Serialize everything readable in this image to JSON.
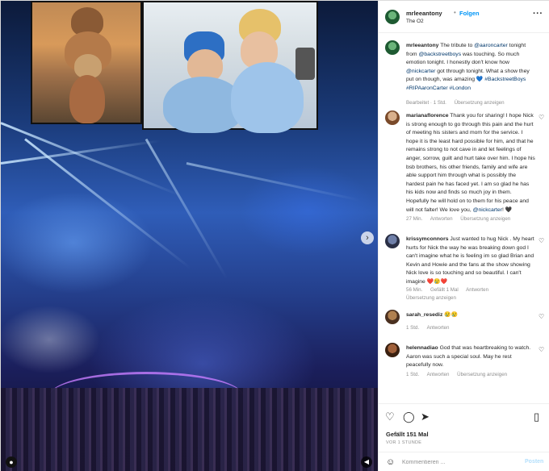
{
  "header": {
    "username": "mrleeantony",
    "separator": "•",
    "follow_label": "Folgen",
    "location": "The O2",
    "more": "···"
  },
  "caption": {
    "username": "mrleeantony",
    "text_1": "The tribute to ",
    "mention_1": "@aaroncarter",
    "text_2": " tonight from ",
    "mention_2": "@backstreetboys",
    "text_3": " was touching. So much emotion tonight. I honestly don't know how ",
    "mention_3": "@nickcarter",
    "text_4": " got through tonight. What a show they put on though, was amazing 💙 ",
    "hashtag_1": "#BackstreetBoys",
    "hashtag_2": "#RIPAaronCarter",
    "hashtag_3": "#London",
    "meta_edited": "Bearbeitet · 1 Std.",
    "meta_translate": "Übersetzung anzeigen"
  },
  "comments": [
    {
      "username": "marianaflorence",
      "text": "Thank you for sharing! I hope Nick is strong enough to go through this pain and the hurt of meeting his sisters and mom for the service. I hope it is the least hard possible for him, and that he remains strong to not cave in and let feelings of anger, sorrow, guilt and hurt take over him. I hope his bsb brothers, his other friends, family and wife are able support him through what is possibly the hardest pain he has faced yet. I am so glad he has his kids now and finds so much joy in them. Hopefully he will hold on to them for his peace and will not falter! We love you, ",
      "mention": "@nickcarter",
      "suffix": "! 🖤",
      "time": "27 Min.",
      "reply": "Antworten",
      "translate": "Übersetzung anzeigen"
    },
    {
      "username": "krissymconnors",
      "text": "Just wanted to hug Nick . My heart hurts for Nick the way he was breaking down god I can't imagine what he is feeling im so glad Brian and Kevin and Howie and the fans at the show showing Nick love is so touching and so beautiful. I can't imagine ❤️😢❤️",
      "time": "56 Min.",
      "likes": "Gefällt 1 Mal",
      "reply": "Antworten",
      "translate": "Übersetzung anzeigen"
    },
    {
      "username": "sarah_resediz",
      "text": "😢😢",
      "time": "1 Std.",
      "reply": "Antworten"
    },
    {
      "username": "helennadiao",
      "text": "God that was heartbreaking to watch. Aaron was such a special soul. May he rest peacefully now.",
      "time": "1 Std.",
      "reply": "Antworten",
      "translate": "Übersetzung anzeigen"
    }
  ],
  "actions": {
    "likes": "Gefällt 151 Mal",
    "time_ago": "VOR 1 STUNDE"
  },
  "comment_box": {
    "placeholder": "Kommentieren ...",
    "post_label": "Posten"
  },
  "colors": {
    "accent": "#0095f6",
    "link": "#00376b",
    "muted": "#8e8e8e",
    "text": "#262626"
  }
}
